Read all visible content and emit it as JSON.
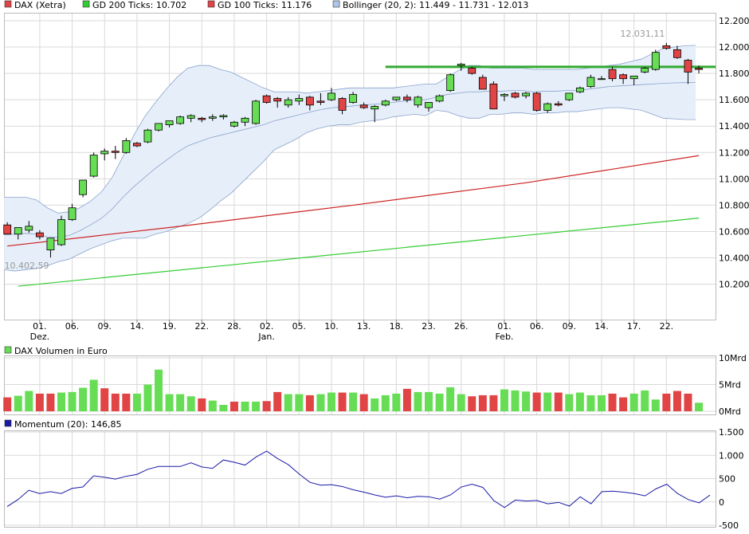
{
  "colors": {
    "up": "#66dd55",
    "down": "#e04444",
    "candle_outline": "#000000",
    "gd200": "#33cc33",
    "gd100": "#cc2222",
    "bollinger_fill": "#e6eef9",
    "bollinger_line": "#8aa3cc",
    "resistance": "#33aa33",
    "momentum": "#1a1aa8",
    "grid": "#d9d9d9",
    "annotation": "#999999"
  },
  "chart_data": [
    {
      "type": "candlestick",
      "legend": [
        {
          "label": "DAX (Xetra)",
          "color": "#e04444"
        },
        {
          "label": "GD 200 Ticks: 10.702",
          "color": "#33cc33"
        },
        {
          "label": "GD 100 Ticks: 11.176",
          "color": "#e04444"
        },
        {
          "label": "Bollinger (20, 2): 11.449 - 11.731 - 12.013",
          "color": "#aec6ea"
        }
      ],
      "ylim": [
        10000,
        12250
      ],
      "y_ticks": [
        10200,
        10400,
        10600,
        10800,
        11000,
        11200,
        11400,
        11600,
        11800,
        12000,
        12200
      ],
      "y_tick_labels": [
        "10.200",
        "10.400",
        "10.600",
        "10.800",
        "11.000",
        "11.200",
        "11.400",
        "11.600",
        "11.800",
        "12.000",
        "12.200"
      ],
      "x_ticks": [
        {
          "index": 3,
          "label": "01.",
          "sub": "Dez."
        },
        {
          "index": 6,
          "label": "06.",
          "sub": ""
        },
        {
          "index": 9,
          "label": "09.",
          "sub": ""
        },
        {
          "index": 12,
          "label": "14.",
          "sub": ""
        },
        {
          "index": 15,
          "label": "19.",
          "sub": ""
        },
        {
          "index": 18,
          "label": "22.",
          "sub": ""
        },
        {
          "index": 21,
          "label": "28.",
          "sub": ""
        },
        {
          "index": 24,
          "label": "02.",
          "sub": "Jan."
        },
        {
          "index": 27,
          "label": "05.",
          "sub": ""
        },
        {
          "index": 30,
          "label": "10.",
          "sub": ""
        },
        {
          "index": 33,
          "label": "13.",
          "sub": ""
        },
        {
          "index": 36,
          "label": "18.",
          "sub": ""
        },
        {
          "index": 39,
          "label": "23.",
          "sub": ""
        },
        {
          "index": 42,
          "label": "26.",
          "sub": ""
        },
        {
          "index": 46,
          "label": "01.",
          "sub": "Feb."
        },
        {
          "index": 49,
          "label": "06.",
          "sub": ""
        },
        {
          "index": 52,
          "label": "09.",
          "sub": ""
        },
        {
          "index": 55,
          "label": "14.",
          "sub": ""
        },
        {
          "index": 58,
          "label": "17.",
          "sub": ""
        },
        {
          "index": 61,
          "label": "22.",
          "sub": ""
        }
      ],
      "candles": [
        [
          10650,
          10670,
          10580,
          10580
        ],
        [
          10580,
          10590,
          10540,
          10630
        ],
        [
          10610,
          10680,
          10590,
          10640
        ],
        [
          10590,
          10610,
          10540,
          10560
        ],
        [
          10460,
          10510,
          10402.59,
          10550
        ],
        [
          10500,
          10720,
          10490,
          10690
        ],
        [
          10690,
          10810,
          10680,
          10780
        ],
        [
          10880,
          10920,
          10860,
          10990
        ],
        [
          11020,
          11200,
          11010,
          11180
        ],
        [
          11190,
          11230,
          11140,
          11210
        ],
        [
          11210,
          11250,
          11150,
          11200
        ],
        [
          11200,
          11310,
          11190,
          11290
        ],
        [
          11270,
          11280,
          11240,
          11250
        ],
        [
          11280,
          11380,
          11270,
          11370
        ],
        [
          11370,
          11420,
          11360,
          11420
        ],
        [
          11410,
          11440,
          11390,
          11440
        ],
        [
          11420,
          11480,
          11410,
          11470
        ],
        [
          11460,
          11490,
          11430,
          11480
        ],
        [
          11460,
          11470,
          11430,
          11450
        ],
        [
          11460,
          11490,
          11440,
          11470
        ],
        [
          11470,
          11490,
          11450,
          11480
        ],
        [
          11400,
          11440,
          11390,
          11430
        ],
        [
          11430,
          11470,
          11400,
          11460
        ],
        [
          11420,
          11600,
          11410,
          11590
        ],
        [
          11630,
          11640,
          11570,
          11580
        ],
        [
          11610,
          11620,
          11540,
          11590
        ],
        [
          11560,
          11620,
          11540,
          11600
        ],
        [
          11590,
          11640,
          11560,
          11610
        ],
        [
          11620,
          11630,
          11520,
          11560
        ],
        [
          11590,
          11650,
          11560,
          11580
        ],
        [
          11600,
          11690,
          11590,
          11650
        ],
        [
          11610,
          11620,
          11490,
          11520
        ],
        [
          11580,
          11660,
          11570,
          11640
        ],
        [
          11560,
          11580,
          11530,
          11540
        ],
        [
          11530,
          11560,
          11430,
          11550
        ],
        [
          11560,
          11600,
          11550,
          11590
        ],
        [
          11600,
          11620,
          11590,
          11620
        ],
        [
          11620,
          11640,
          11580,
          11600
        ],
        [
          11560,
          11630,
          11540,
          11620
        ],
        [
          11540,
          11580,
          11510,
          11580
        ],
        [
          11590,
          11640,
          11580,
          11630
        ],
        [
          11670,
          11800,
          11660,
          11790
        ],
        [
          11860,
          11880,
          11820,
          11870
        ],
        [
          11840,
          11850,
          11790,
          11800
        ],
        [
          11770,
          11790,
          11680,
          11680
        ],
        [
          11720,
          11740,
          11530,
          11530
        ],
        [
          11630,
          11650,
          11590,
          11640
        ],
        [
          11650,
          11660,
          11610,
          11620
        ],
        [
          11630,
          11660,
          11610,
          11650
        ],
        [
          11650,
          11660,
          11510,
          11520
        ],
        [
          11520,
          11580,
          11500,
          11570
        ],
        [
          11570,
          11590,
          11550,
          11560
        ],
        [
          11600,
          11650,
          11590,
          11650
        ],
        [
          11660,
          11700,
          11650,
          11690
        ],
        [
          11700,
          11790,
          11690,
          11770
        ],
        [
          11760,
          11780,
          11750,
          11760
        ],
        [
          11830,
          11850,
          11740,
          11760
        ],
        [
          11790,
          11800,
          11720,
          11760
        ],
        [
          11760,
          11780,
          11710,
          11780
        ],
        [
          11810,
          11850,
          11800,
          11840
        ],
        [
          11830,
          11980,
          11820,
          11960
        ],
        [
          12010,
          12031.11,
          11980,
          11990
        ],
        [
          11980,
          12010,
          11910,
          11920
        ],
        [
          11900,
          11910,
          11720,
          11810
        ],
        [
          11840,
          11860,
          11800,
          11830
        ]
      ],
      "gd200": {
        "x": [
          1,
          64
        ],
        "y": [
          10185,
          10702
        ]
      },
      "gd100": {
        "x": [
          0,
          16,
          32,
          48,
          64
        ],
        "y": [
          10490,
          10640,
          10800,
          10970,
          11176
        ]
      },
      "bollinger_upper": [
        10860,
        10860,
        10860,
        10840,
        10780,
        10740,
        10750,
        10780,
        10830,
        10900,
        11010,
        11170,
        11330,
        11470,
        11580,
        11680,
        11770,
        11840,
        11860,
        11860,
        11830,
        11810,
        11770,
        11730,
        11690,
        11660,
        11660,
        11660,
        11650,
        11660,
        11670,
        11680,
        11690,
        11690,
        11690,
        11690,
        11690,
        11700,
        11710,
        11720,
        11720,
        11770,
        11820,
        11860,
        11860,
        11840,
        11840,
        11840,
        11840,
        11830,
        11830,
        11830,
        11830,
        11830,
        11840,
        11850,
        11860,
        11870,
        11890,
        11910,
        11950,
        11990,
        12000,
        12010,
        12013
      ],
      "bollinger_middle": [
        10575,
        10580,
        10585,
        10580,
        10560,
        10555,
        10570,
        10605,
        10650,
        10700,
        10770,
        10860,
        10940,
        11010,
        11080,
        11140,
        11200,
        11250,
        11280,
        11310,
        11330,
        11350,
        11370,
        11390,
        11410,
        11440,
        11460,
        11480,
        11500,
        11520,
        11535,
        11545,
        11550,
        11560,
        11565,
        11570,
        11580,
        11590,
        11600,
        11600,
        11620,
        11640,
        11650,
        11660,
        11660,
        11665,
        11665,
        11670,
        11670,
        11660,
        11665,
        11665,
        11670,
        11670,
        11680,
        11690,
        11700,
        11705,
        11710,
        11715,
        11720,
        11725,
        11728,
        11730,
        11731
      ],
      "bollinger_lower": [
        10310,
        10300,
        10310,
        10320,
        10340,
        10370,
        10390,
        10430,
        10470,
        10500,
        10530,
        10550,
        10550,
        10550,
        10580,
        10600,
        10630,
        10660,
        10700,
        10760,
        10830,
        10890,
        10970,
        11050,
        11130,
        11220,
        11260,
        11300,
        11350,
        11380,
        11400,
        11410,
        11410,
        11430,
        11440,
        11450,
        11470,
        11480,
        11490,
        11480,
        11520,
        11510,
        11480,
        11460,
        11460,
        11490,
        11490,
        11500,
        11500,
        11490,
        11500,
        11500,
        11510,
        11510,
        11520,
        11530,
        11540,
        11540,
        11530,
        11520,
        11490,
        11460,
        11455,
        11450,
        11449
      ],
      "resistance": {
        "from_index": 35,
        "value": 11850
      },
      "annotations": [
        {
          "index": 61,
          "value": 12031.11,
          "label": "12.031,11"
        },
        {
          "index": 4,
          "value": 10402.59,
          "label": "10.402,59"
        }
      ]
    },
    {
      "type": "bar",
      "legend": [
        {
          "label": "DAX Volumen in Euro",
          "color": "#66dd55"
        }
      ],
      "ylim": [
        0,
        10
      ],
      "y_tick_labels": [
        "10Mrd",
        "5Mrd",
        "0Mrd"
      ],
      "values": [
        2.6,
        2.9,
        3.8,
        3.3,
        3.3,
        3.5,
        3.6,
        4.4,
        5.9,
        4.3,
        3.3,
        3.3,
        3.3,
        5.0,
        7.8,
        3.2,
        3.2,
        2.8,
        2.4,
        2.0,
        1.2,
        1.8,
        1.8,
        1.8,
        1.9,
        3.6,
        3.2,
        3.2,
        3.0,
        3.2,
        3.5,
        3.5,
        3.5,
        3.2,
        2.4,
        3.0,
        3.3,
        4.2,
        3.6,
        3.6,
        3.3,
        4.5,
        3.2,
        2.8,
        3.0,
        3.0,
        4.1,
        3.9,
        3.7,
        3.5,
        3.5,
        3.5,
        3.2,
        3.5,
        3.0,
        3.0,
        3.3,
        2.6,
        3.3,
        3.9,
        2.2,
        3.3,
        3.8,
        3.3,
        1.6
      ],
      "directions": [
        0,
        1,
        1,
        0,
        0,
        1,
        1,
        1,
        1,
        0,
        0,
        0,
        1,
        1,
        1,
        1,
        1,
        1,
        0,
        1,
        1,
        0,
        1,
        1,
        0,
        0,
        1,
        1,
        0,
        1,
        1,
        0,
        1,
        0,
        1,
        1,
        1,
        0,
        1,
        1,
        1,
        1,
        1,
        0,
        0,
        0,
        1,
        1,
        1,
        0,
        1,
        0,
        1,
        1,
        1,
        1,
        0,
        0,
        1,
        1,
        1,
        0,
        0,
        0,
        1
      ]
    },
    {
      "type": "line",
      "legend": [
        {
          "label": "Momentum (20): 146,85",
          "color": "#1a1aa8"
        }
      ],
      "ylim": [
        -500,
        1500
      ],
      "y_ticks": [
        -500,
        0,
        500,
        1000,
        1500
      ],
      "y_tick_labels": [
        "-500",
        "0",
        "500",
        "1.000",
        "1.500"
      ],
      "values": [
        -100,
        50,
        250,
        180,
        220,
        180,
        290,
        320,
        560,
        530,
        490,
        550,
        590,
        700,
        760,
        760,
        760,
        840,
        750,
        720,
        900,
        850,
        790,
        960,
        1090,
        930,
        800,
        600,
        420,
        360,
        370,
        330,
        260,
        210,
        150,
        100,
        130,
        90,
        120,
        110,
        60,
        150,
        320,
        380,
        310,
        30,
        -120,
        40,
        20,
        30,
        -40,
        -10,
        -90,
        110,
        -40,
        220,
        230,
        210,
        180,
        130,
        280,
        380,
        180,
        50,
        -20,
        146.85
      ]
    }
  ]
}
